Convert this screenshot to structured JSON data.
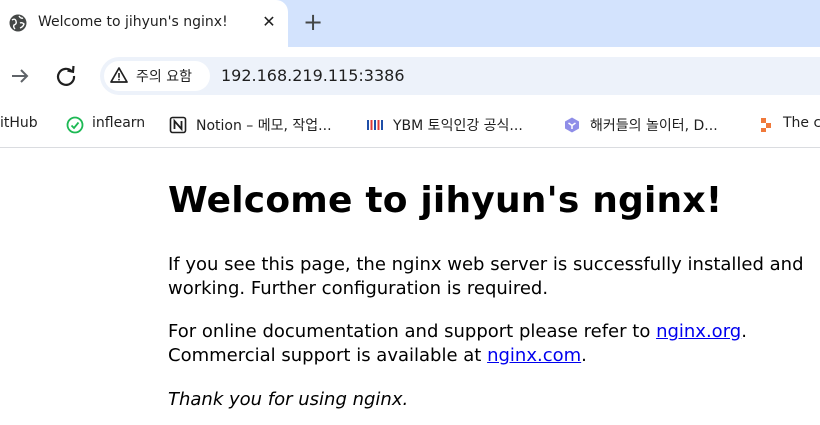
{
  "tab": {
    "title": "Welcome to jihyun's nginx!",
    "close_glyph": "✕",
    "new_tab_glyph": "+"
  },
  "toolbar": {
    "security_warning": "주의 요함",
    "url": "192.168.219.115:3386"
  },
  "bookmarks": [
    {
      "label": "itHub",
      "icon": "github-icon"
    },
    {
      "label": "inflearn",
      "icon": "inflearn-icon"
    },
    {
      "label": "Notion – 메모, 작업...",
      "icon": "notion-icon"
    },
    {
      "label": "YBM 토익인강 공식...",
      "icon": "ybm-icon"
    },
    {
      "label": "해커들의 놀이터, D...",
      "icon": "dreamhack-icon"
    },
    {
      "label": "The c",
      "icon": "the-c-icon"
    }
  ],
  "page": {
    "heading": "Welcome to jihyun's nginx!",
    "para1": "If you see this page, the nginx web server is successfully installed and working. Further configuration is required.",
    "para2_prefix": "For online documentation and support please refer to ",
    "para2_link": "nginx.org",
    "para2_after_link": ".",
    "para2_line2_prefix": "Commercial support is available at ",
    "para2_line2_link": "nginx.com",
    "para2_line2_after_link": ".",
    "thanks": "Thank you for using nginx."
  },
  "colors": {
    "tabbar": "#d3e3fd",
    "omnibox": "#edf2fa",
    "link": "#0000ee"
  }
}
